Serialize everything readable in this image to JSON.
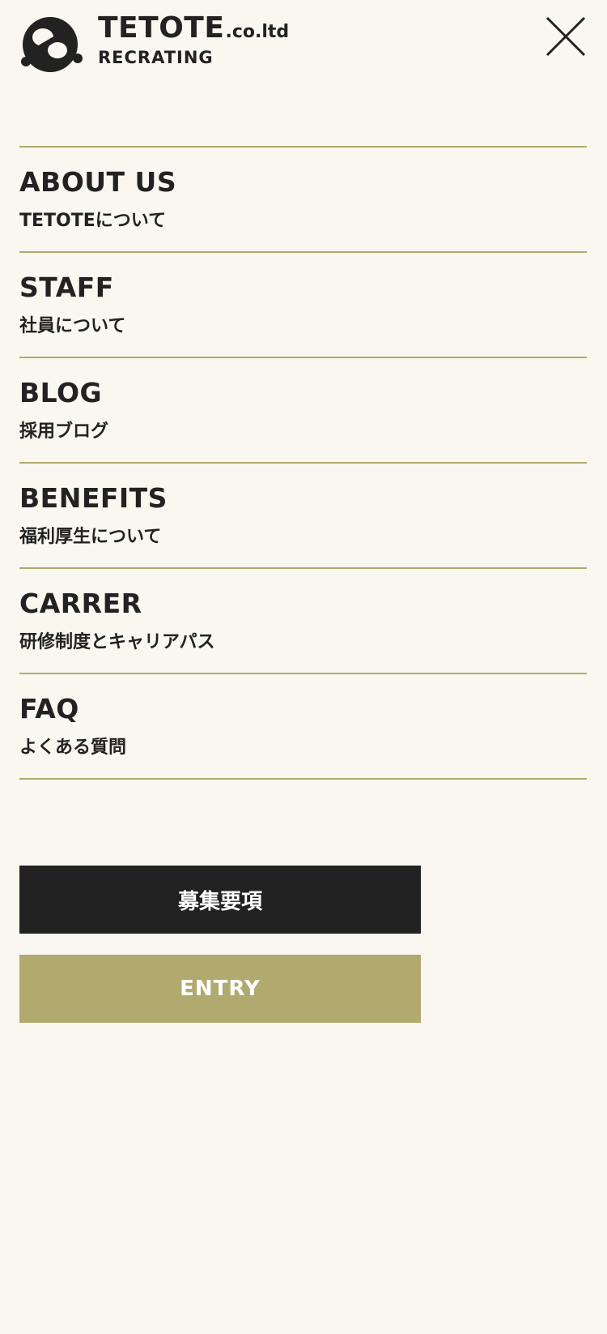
{
  "header": {
    "brand_name": "TETOTE",
    "brand_suffix": ".co.ltd",
    "brand_sub": "RECRATING",
    "logo_icon": "tetote-knot-logo-icon",
    "close_icon": "close-icon"
  },
  "nav": {
    "items": [
      {
        "en": "ABOUT US",
        "ja": "TETOTEについて"
      },
      {
        "en": "STAFF",
        "ja": "社員について"
      },
      {
        "en": "BLOG",
        "ja": "採用ブログ"
      },
      {
        "en": "BENEFITS",
        "ja": "福利厚生について"
      },
      {
        "en": "CARRER",
        "ja": "研修制度とキャリアパス"
      },
      {
        "en": "FAQ",
        "ja": "よくある質問"
      }
    ]
  },
  "buttons": {
    "recruit_label": "募集要項",
    "entry_label": "ENTRY"
  },
  "colors": {
    "background": "#f9f7f0",
    "text": "#222222",
    "accent": "#b0aa6e",
    "dark_button": "#222222"
  }
}
